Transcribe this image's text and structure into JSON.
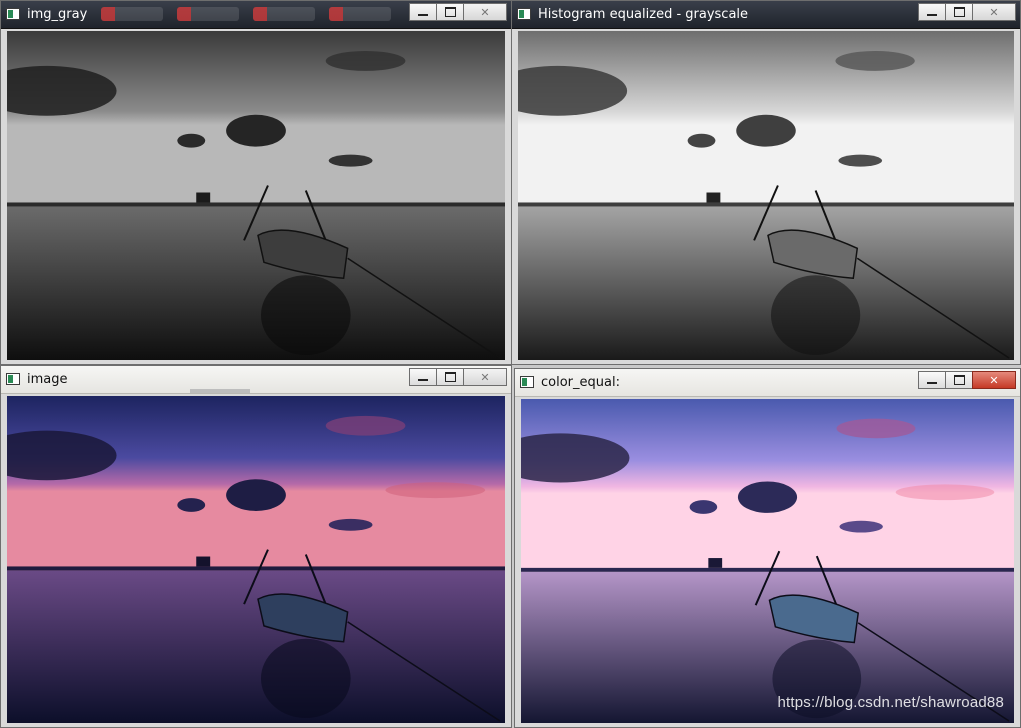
{
  "windows": [
    {
      "id": "img_gray",
      "title": "img_gray",
      "style": "grayscale",
      "titlebar_theme": "dark"
    },
    {
      "id": "hist_eq",
      "title": "Histogram equalized - grayscale",
      "style": "grayscale-bright",
      "titlebar_theme": "dark"
    },
    {
      "id": "image",
      "title": "image",
      "style": "color",
      "titlebar_theme": "light"
    },
    {
      "id": "color_equal",
      "title": "color_equal:",
      "style": "color-bright",
      "titlebar_theme": "light"
    }
  ],
  "controls": {
    "minimize_glyph": "—",
    "maximize_glyph": "▢",
    "close_glyph": "✕"
  },
  "watermark": "https://blog.csdn.net/shawroad88",
  "colors": {
    "desktop": "#c9c9c9",
    "titlebar_dark": "#2a2f38",
    "titlebar_light": "#eeeeec",
    "close_active": "#c53a26"
  },
  "icons": [
    "app-window-icon",
    "minimize-icon",
    "maximize-icon",
    "close-icon"
  ]
}
